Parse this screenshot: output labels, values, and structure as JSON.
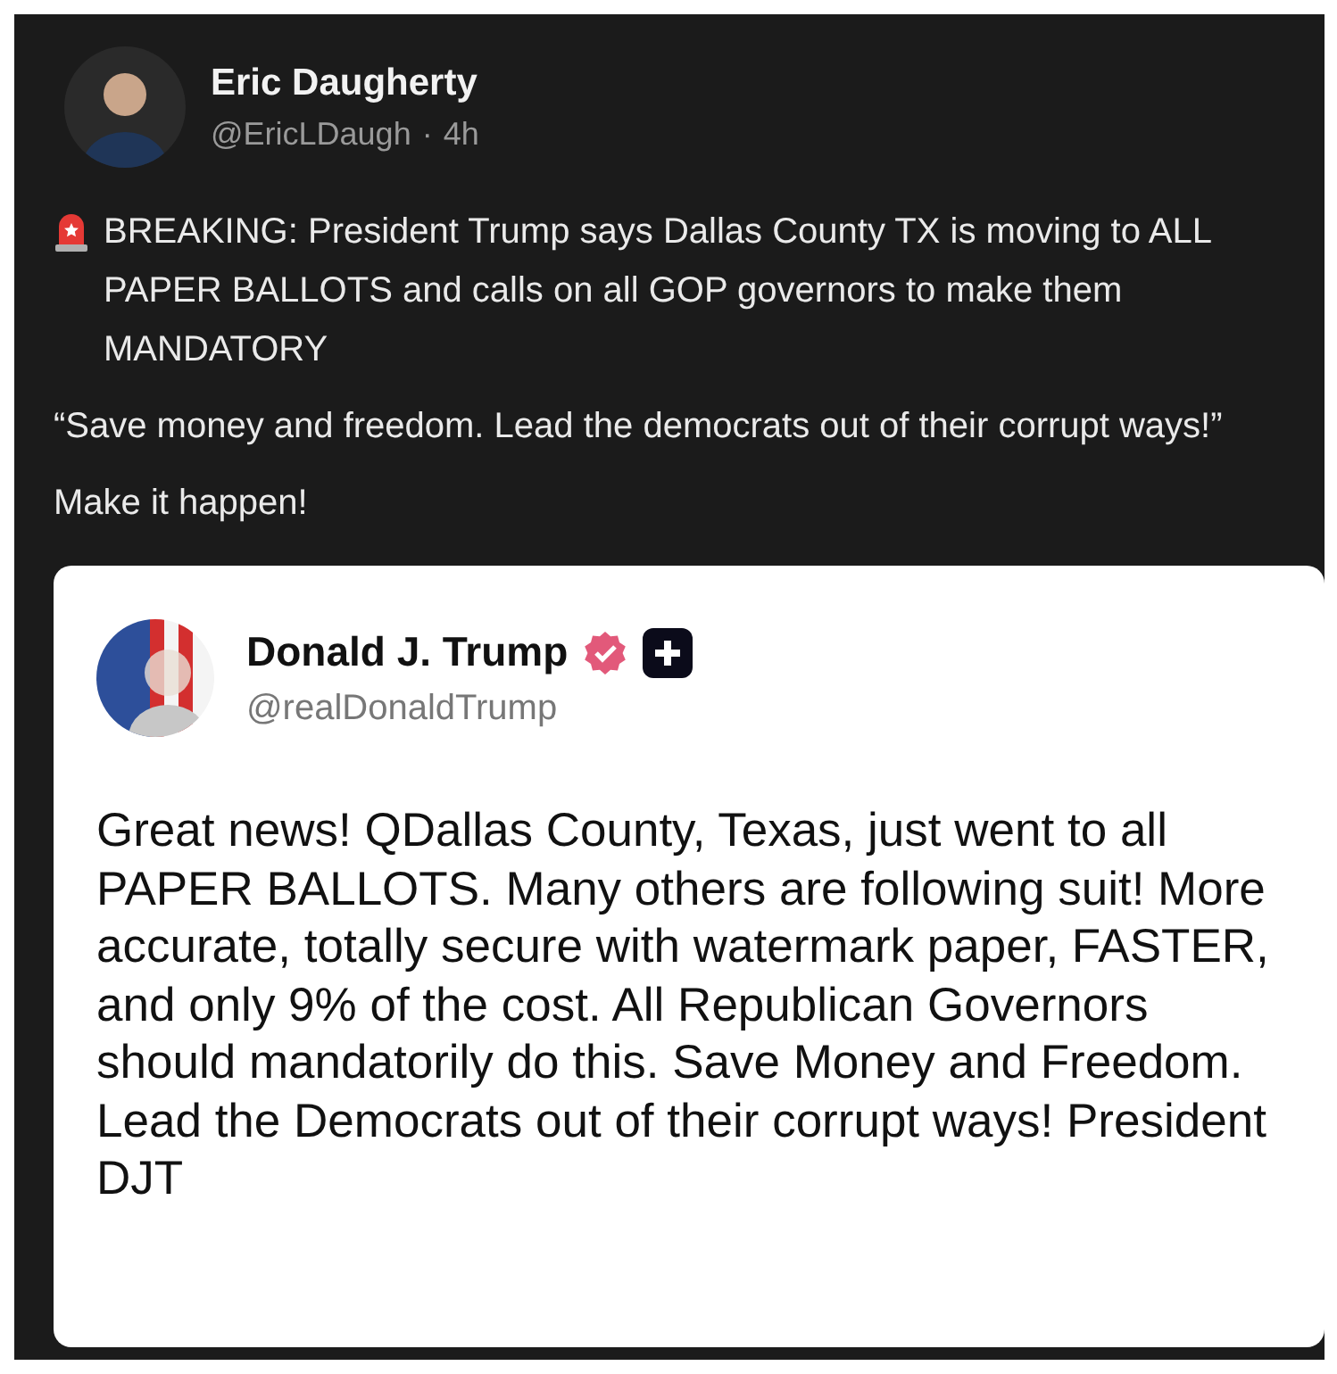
{
  "post": {
    "author": {
      "name": "Eric Daugherty",
      "handle": "@EricLDaugh",
      "separator": "·",
      "time": "4h"
    },
    "paragraphs": [
      {
        "kind": "alert",
        "text": "BREAKING: President Trump says Dallas County TX is moving to ALL PAPER BALLOTS and calls on all GOP governors to make them MANDATORY"
      },
      {
        "kind": "plain",
        "text": "“Save money and freedom. Lead the democrats out of their corrupt ways!”"
      },
      {
        "kind": "plain",
        "text": "Make it happen!"
      }
    ],
    "quoted": {
      "author": {
        "name": "Donald J. Trump",
        "handle": "@realDonaldTrump",
        "verified": true
      },
      "text": "Great news! QDallas County, Texas, just went to all PAPER BALLOTS. Many others are following suit! More accurate, totally secure with watermark paper, FASTER, and only 9% of the cost. All Republican Governors should mandatorily do this. Save Money and Freedom. Lead the Democrats out of their corrupt ways! President DJT"
    }
  }
}
